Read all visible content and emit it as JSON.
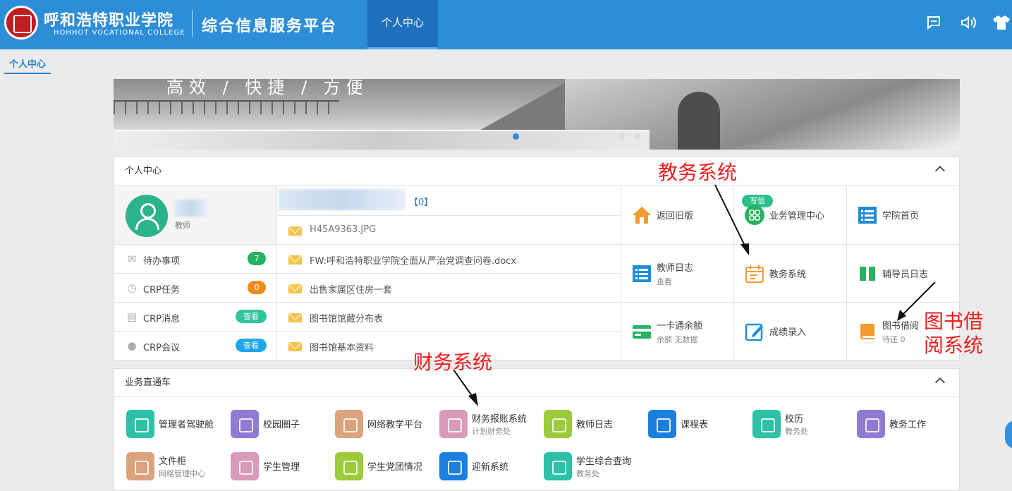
{
  "header": {
    "school_cn": "呼和浩特职业学院",
    "school_en": "HOHHOT VOCATIONAL COLLEGE",
    "platform": "综合信息服务平台",
    "active_tab": "个人中心",
    "icons": [
      "chat-icon",
      "speaker-icon",
      "shirt-icon"
    ],
    "color": "#2d8ed7"
  },
  "subnav": {
    "tab": "个人中心"
  },
  "banner": {
    "slogan": "高效 / 快捷 / 方便"
  },
  "personal": {
    "title": "个人中心",
    "profile": {
      "role": "教师"
    },
    "stats": [
      {
        "label": "待办事项",
        "badge": "7",
        "color": "#27b163",
        "icon": "envelope-icon"
      },
      {
        "label": "CRP任务",
        "badge": "0",
        "color": "#f08a1c",
        "icon": "clock-icon"
      },
      {
        "label": "CRP消息",
        "badge": "查看",
        "color": "#32c49c",
        "icon": "clipboard-icon"
      },
      {
        "label": "CRP会议",
        "badge": "查看",
        "color": "#1ea6e8",
        "icon": "comment-icon"
      }
    ],
    "mail": {
      "count": "【0】",
      "write": "写信",
      "items": [
        "H45A9363.JPG",
        "FW:呼和浩特职业学院全面从严治党调查问卷.docx",
        "出售家属区住房一套",
        "图书馆馆藏分布表",
        "图书馆基本资料"
      ]
    },
    "shortcuts": [
      {
        "title": "返回旧版",
        "sub": "",
        "icon": "house-icon",
        "color": "#f29a2e"
      },
      {
        "title": "业务管理中心",
        "sub": "",
        "icon": "grid-icon",
        "color": "#27b163"
      },
      {
        "title": "学院首页",
        "sub": "",
        "icon": "list-icon",
        "color": "#1f8ed8"
      },
      {
        "title": "教师日志",
        "sub": "查看",
        "icon": "list-icon",
        "color": "#1f8ed8"
      },
      {
        "title": "教务系统",
        "sub": "",
        "icon": "calendar-icon",
        "color": "#f29a2e"
      },
      {
        "title": "辅导员日志",
        "sub": "",
        "icon": "book-pair-icon",
        "color": "#27b163"
      },
      {
        "title": "一卡通余额",
        "sub": "余额 无数据",
        "icon": "card-icon",
        "color": "#27b163"
      },
      {
        "title": "成绩录入",
        "sub": "",
        "icon": "edit-icon",
        "color": "#1f8ed8"
      },
      {
        "title": "图书借阅",
        "sub": "待还 0",
        "icon": "book-icon",
        "color": "#f29a2e"
      }
    ]
  },
  "business": {
    "title": "业务直通车",
    "apps": [
      {
        "title": "管理者驾驶舱",
        "sub": "",
        "color": "#2ec1a7"
      },
      {
        "title": "校园圈子",
        "sub": "",
        "color": "#8f7bd3"
      },
      {
        "title": "网络教学平台",
        "sub": "",
        "color": "#dca27e"
      },
      {
        "title": "财务报账系统",
        "sub": "计划财务处",
        "color": "#d99ab8"
      },
      {
        "title": "教师日志",
        "sub": "",
        "color": "#9ccb3b"
      },
      {
        "title": "课程表",
        "sub": "",
        "color": "#1b7fe0"
      },
      {
        "title": "校历",
        "sub": "教务处",
        "color": "#2ec1a7"
      },
      {
        "title": "教务工作",
        "sub": "",
        "color": "#8f7bd3"
      },
      {
        "title": "文件柜",
        "sub": "网络管理中心",
        "color": "#dca27e"
      },
      {
        "title": "学生管理",
        "sub": "",
        "color": "#d99ab8"
      },
      {
        "title": "学生党团情况",
        "sub": "",
        "color": "#9ccb3b"
      },
      {
        "title": "迎新系统",
        "sub": "",
        "color": "#1b7fe0"
      },
      {
        "title": "学生综合查询",
        "sub": "教务处",
        "color": "#2ec1a7"
      }
    ]
  },
  "annotations": {
    "edu": "教务系统",
    "finance": "财务系统",
    "library": "图书借阅系统"
  }
}
